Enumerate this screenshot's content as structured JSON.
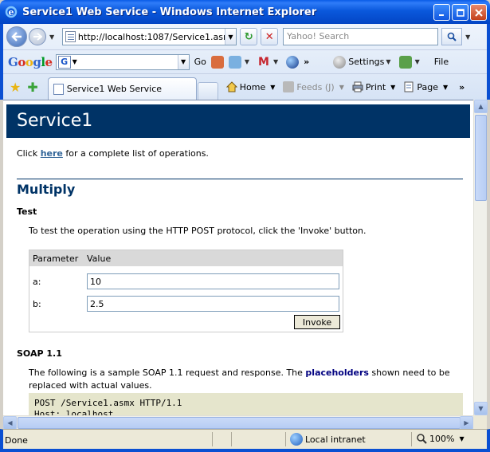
{
  "window": {
    "title": "Service1 Web Service - Windows Internet Explorer"
  },
  "nav": {
    "address": "http://localhost:1087/Service1.asmx?",
    "search_placeholder": "Yahoo! Search"
  },
  "google_bar": {
    "go_label": "Go",
    "settings_label": "Settings",
    "file_label": "File"
  },
  "tabs": [
    {
      "label": "Service1 Web Service"
    }
  ],
  "command_bar": {
    "home": "Home",
    "feeds": "Feeds (J)",
    "print": "Print",
    "page": "Page"
  },
  "page": {
    "service_name": "Service1",
    "intro_before": "Click ",
    "intro_link": "here",
    "intro_after": " for a complete list of operations.",
    "operation": "Multiply",
    "test_heading": "Test",
    "test_text": "To test the operation using the HTTP POST protocol, click the 'Invoke' button.",
    "form": {
      "col_parameter": "Parameter",
      "col_value": "Value",
      "params": [
        {
          "label": "a:",
          "value": "10"
        },
        {
          "label": "b:",
          "value": "2.5"
        }
      ],
      "invoke_label": "Invoke"
    },
    "soap_heading": "SOAP 1.1",
    "soap_text_before": "The following is a sample SOAP 1.1 request and response. The ",
    "soap_placeholders": "placeholders",
    "soap_text_after": " shown need to be replaced with actual values.",
    "code_line1": "POST /Service1.asmx HTTP/1.1",
    "code_line2": "Host: localhost"
  },
  "status": {
    "text": "Done",
    "zone": "Local intranet",
    "zoom": "100%"
  },
  "colors": {
    "header_bg": "#003366",
    "link": "#336699",
    "code_bg": "#e5e5cc",
    "placeholder": "#000080"
  }
}
